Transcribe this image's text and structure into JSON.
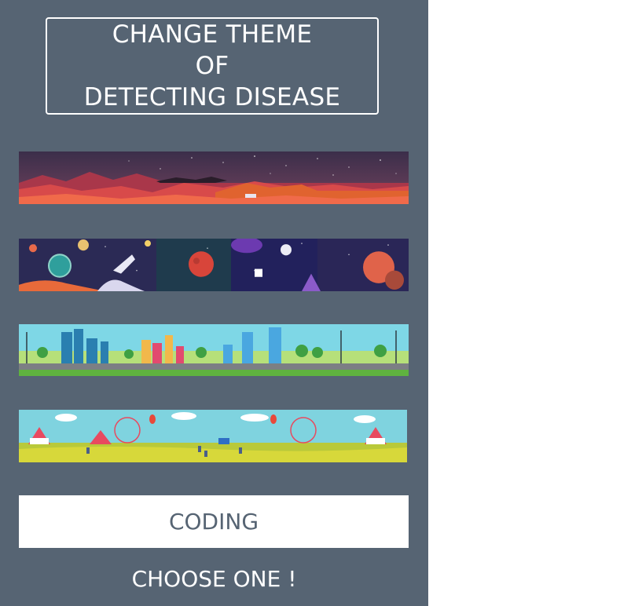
{
  "panel": {
    "title_lines": [
      "CHANGE THEME",
      "OF",
      "DETECTING DISEASE"
    ],
    "themes": [
      {
        "name": "mars-landscape",
        "selected": false
      },
      {
        "name": "space-planets",
        "selected": false
      },
      {
        "name": "city-park",
        "selected": false
      },
      {
        "name": "amusement-fair",
        "selected": false
      }
    ],
    "current_theme_label": "CODING",
    "prompt": "CHOOSE ONE !"
  },
  "colors": {
    "sidebar_bg": "#566473",
    "page_bg": "#ffffff",
    "text_light": "#ffffff",
    "button_text": "#566473"
  }
}
